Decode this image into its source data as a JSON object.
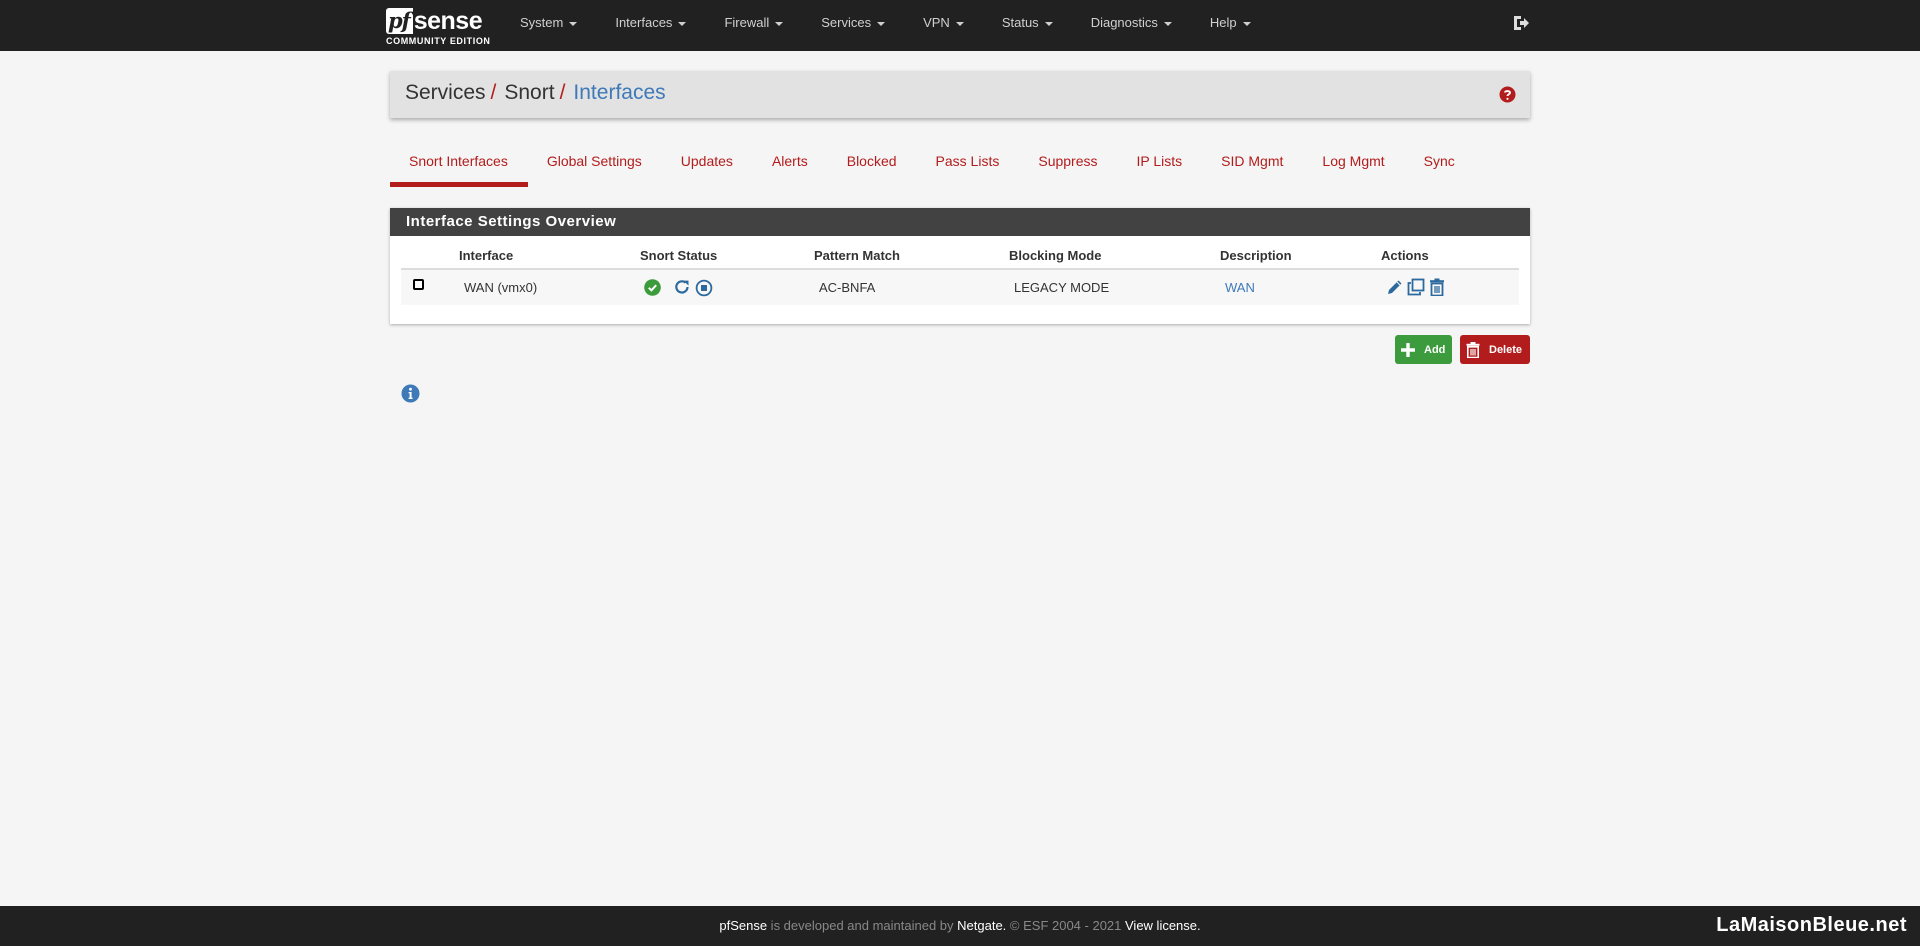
{
  "brand": {
    "logo_text": "pfsense",
    "edition": "COMMUNITY EDITION"
  },
  "nav": {
    "items": [
      {
        "label": "System"
      },
      {
        "label": "Interfaces"
      },
      {
        "label": "Firewall"
      },
      {
        "label": "Services"
      },
      {
        "label": "VPN"
      },
      {
        "label": "Status"
      },
      {
        "label": "Diagnostics"
      },
      {
        "label": "Help"
      }
    ]
  },
  "breadcrumb": {
    "level1": "Services",
    "level2": "Snort",
    "current": "Interfaces",
    "separator": "/"
  },
  "tabs": [
    {
      "label": "Snort Interfaces",
      "active": true
    },
    {
      "label": "Global Settings"
    },
    {
      "label": "Updates"
    },
    {
      "label": "Alerts"
    },
    {
      "label": "Blocked"
    },
    {
      "label": "Pass Lists"
    },
    {
      "label": "Suppress"
    },
    {
      "label": "IP Lists"
    },
    {
      "label": "SID Mgmt"
    },
    {
      "label": "Log Mgmt"
    },
    {
      "label": "Sync"
    }
  ],
  "panel": {
    "title": "Interface Settings Overview",
    "columns": [
      "Interface",
      "Snort Status",
      "Pattern Match",
      "Blocking Mode",
      "Description",
      "Actions"
    ],
    "rows": [
      {
        "interface": "WAN (vmx0)",
        "pattern_match": "AC-BNFA",
        "blocking_mode": "LEGACY MODE",
        "description": "WAN",
        "status": "running"
      }
    ]
  },
  "buttons": {
    "add": "Add",
    "delete": "Delete"
  },
  "footer": {
    "product": "pfSense",
    "middle": " is developed and maintained by ",
    "company": "Netgate.",
    "copyright": " © ESF 2004 - 2021 ",
    "license": "View license.",
    "watermark": "LaMaisonBleue.net"
  },
  "colors": {
    "accent": "#b31c1c",
    "link": "#3e79b8",
    "success": "#3c9b3c",
    "navbar": "#212121"
  }
}
